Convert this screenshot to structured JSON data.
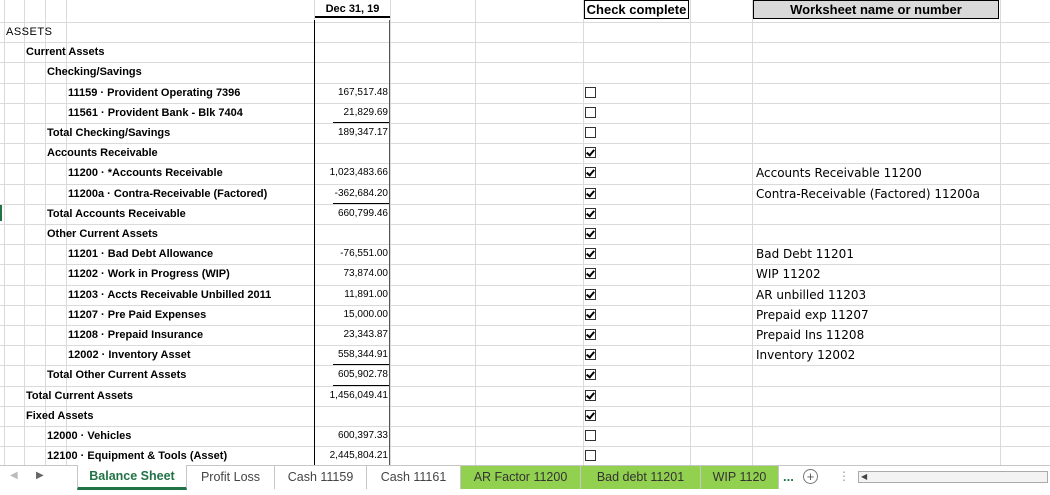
{
  "headers": {
    "date": "Dec 31, 19",
    "check": "Check complete",
    "worksheet": "Worksheet name or number"
  },
  "rows": [
    {
      "label": "ASSETS",
      "level": 0,
      "amount": "",
      "checked": null,
      "note": ""
    },
    {
      "label": "Current Assets",
      "level": 1,
      "amount": "",
      "checked": null,
      "note": ""
    },
    {
      "label": "Checking/Savings",
      "level": 2,
      "amount": "",
      "checked": null,
      "note": ""
    },
    {
      "label": "11159 · Provident Operating 7396",
      "level": 3,
      "amount": "167,517.48",
      "checked": false,
      "note": ""
    },
    {
      "label": "11561 · Provident Bank - Blk 7404",
      "level": 3,
      "amount": "21,829.69",
      "checked": false,
      "note": ""
    },
    {
      "label": "Total Checking/Savings",
      "level": 2,
      "amount": "189,347.17",
      "checked": false,
      "note": ""
    },
    {
      "label": "Accounts Receivable",
      "level": 2,
      "amount": "",
      "checked": true,
      "note": ""
    },
    {
      "label": "11200 · *Accounts Receivable",
      "level": 3,
      "amount": "1,023,483.66",
      "checked": true,
      "note": "Accounts Receivable 11200"
    },
    {
      "label": "11200a · Contra-Receivable (Factored)",
      "level": 3,
      "amount": "-362,684.20",
      "checked": true,
      "note": "Contra-Receivable (Factored) 11200a"
    },
    {
      "label": "Total Accounts Receivable",
      "level": 2,
      "amount": "660,799.46",
      "checked": true,
      "note": ""
    },
    {
      "label": "Other Current Assets",
      "level": 2,
      "amount": "",
      "checked": true,
      "note": ""
    },
    {
      "label": "11201 · Bad Debt Allowance",
      "level": 3,
      "amount": "-76,551.00",
      "checked": true,
      "note": "Bad Debt 11201"
    },
    {
      "label": "11202 · Work in Progress (WIP)",
      "level": 3,
      "amount": "73,874.00",
      "checked": true,
      "note": "WIP 11202"
    },
    {
      "label": "11203 · Accts Receivable Unbilled 2011",
      "level": 3,
      "amount": "11,891.00",
      "checked": true,
      "note": "AR unbilled 11203"
    },
    {
      "label": "11207 · Pre Paid Expenses",
      "level": 3,
      "amount": "15,000.00",
      "checked": true,
      "note": "Prepaid exp 11207"
    },
    {
      "label": "11208 · Prepaid Insurance",
      "level": 3,
      "amount": "23,343.87",
      "checked": true,
      "note": "Prepaid Ins 11208"
    },
    {
      "label": "12002 · Inventory Asset",
      "level": 3,
      "amount": "558,344.91",
      "checked": true,
      "note": "Inventory 12002"
    },
    {
      "label": "Total Other Current Assets",
      "level": 2,
      "amount": "605,902.78",
      "checked": true,
      "note": ""
    },
    {
      "label": "Total Current Assets",
      "level": 1,
      "amount": "1,456,049.41",
      "checked": true,
      "note": ""
    },
    {
      "label": "Fixed Assets",
      "level": 1,
      "amount": "",
      "checked": true,
      "note": ""
    },
    {
      "label": "12000 · Vehicles",
      "level": 2,
      "amount": "600,397.33",
      "checked": false,
      "note": ""
    },
    {
      "label": "12100 · Equipment & Tools (Asset)",
      "level": 2,
      "amount": "2,445,804.21",
      "checked": false,
      "note": ""
    }
  ],
  "tabs": [
    {
      "label": "Balance Sheet",
      "style": "active"
    },
    {
      "label": "Profit Loss",
      "style": "normal"
    },
    {
      "label": "Cash 11159",
      "style": "normal"
    },
    {
      "label": "Cash 11161",
      "style": "normal"
    },
    {
      "label": "AR Factor 11200",
      "style": "green"
    },
    {
      "label": "Bad debt 11201",
      "style": "green"
    },
    {
      "label": "WIP 1120",
      "style": "green"
    }
  ],
  "tabbar": {
    "more": "...",
    "add": "+",
    "options": "⋮"
  },
  "colors": {
    "tab_green": "#92d050",
    "active_tab_text": "#217346",
    "header_fill": "#d9d9d9"
  },
  "icons": {
    "prev_sheet": "caret-left-icon",
    "next_sheet": "caret-right-icon",
    "add_sheet": "plus-circle-icon"
  }
}
